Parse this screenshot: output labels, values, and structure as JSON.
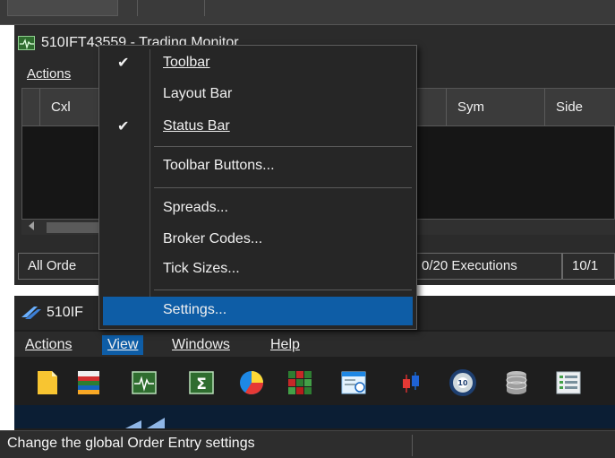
{
  "monitor_window": {
    "title": "510IFT43559 - Trading Monitor",
    "menu_actions": "Actions",
    "columns": [
      "Cxl",
      "Sym",
      "Side"
    ],
    "status_segments": [
      "All Orde",
      "0/20 Executions",
      "10/1"
    ]
  },
  "context_menu": {
    "items": [
      {
        "label": "Toolbar",
        "checked": true
      },
      {
        "label": "Layout Bar",
        "checked": false
      },
      {
        "label": "Status Bar",
        "checked": true
      },
      {
        "label": "Toolbar Buttons...",
        "checked": false
      },
      {
        "label": "Spreads...",
        "checked": false
      },
      {
        "label": "Broker Codes...",
        "checked": false
      },
      {
        "label": "Tick Sizes...",
        "checked": false
      },
      {
        "label": "Settings...",
        "checked": false,
        "highlighted": true
      }
    ],
    "check_glyph": "✔"
  },
  "order_window": {
    "title": "510IF",
    "menu": [
      "Actions",
      "View",
      "Windows",
      "Help"
    ],
    "active_menu": "View",
    "toolbar_icons": [
      "new-document-icon",
      "color-bars-icon",
      "monitor-chart-icon",
      "sigma-icon",
      "pie-chart-icon",
      "heatmap-icon",
      "calendar-window-icon",
      "candlestick-icon",
      "ten-ball-icon",
      "database-icon",
      "list-icon"
    ]
  },
  "status_bar": {
    "text": "Change the global Order Entry settings"
  },
  "colors": {
    "highlight": "#0e5da6",
    "background": "#2b2b2b",
    "menu_background": "#262626"
  }
}
